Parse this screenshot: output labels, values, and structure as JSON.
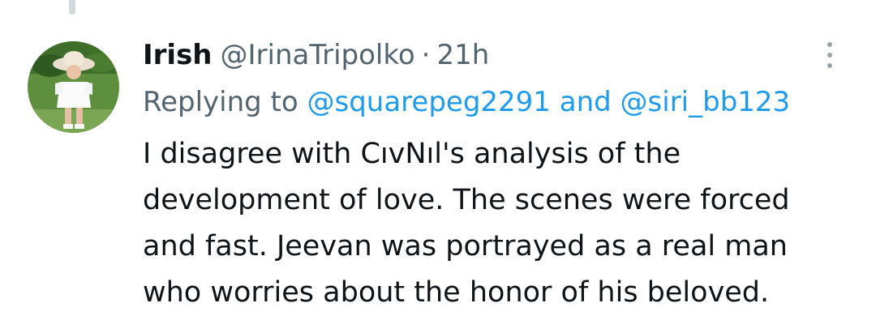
{
  "tweet": {
    "display_name": "Irish",
    "handle": "@IrinaTripolko",
    "separator": "·",
    "time": "21h",
    "more_icon": "more-vertical-icon",
    "reply": {
      "prefix": "Replying to",
      "mention_1": "@squarepeg2291",
      "conjunction": "and",
      "mention_2": "@siri_bb123"
    },
    "body_lines": [
      "I disagree with CıvNıl's analysis of the",
      "development of love. The scenes were forced",
      "and fast. Jeevan was portrayed as a real man",
      "who worries about the honor of his beloved."
    ]
  },
  "colors": {
    "text": "#0f1419",
    "secondary": "#536471",
    "link": "#1d9bf0",
    "thread_line": "#cfd9de"
  }
}
